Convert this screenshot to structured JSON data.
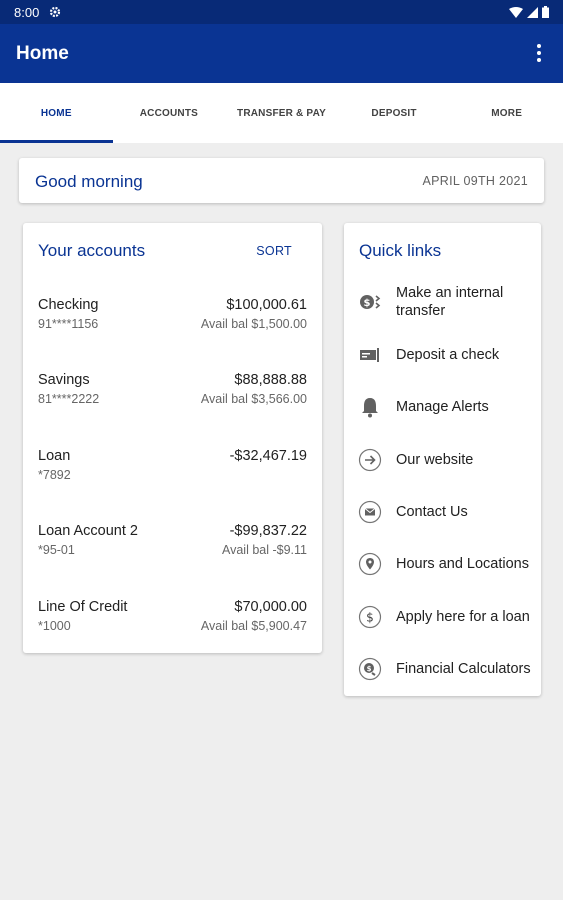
{
  "status": {
    "time": "8:00"
  },
  "appbar": {
    "title": "Home"
  },
  "tabs": [
    {
      "label": "HOME"
    },
    {
      "label": "ACCOUNTS"
    },
    {
      "label": "TRANSFER & PAY"
    },
    {
      "label": "DEPOSIT"
    },
    {
      "label": "MORE"
    }
  ],
  "greeting": {
    "text": "Good morning",
    "date": "APRIL 09TH 2021"
  },
  "accounts": {
    "title": "Your accounts",
    "sort_label": "SORT",
    "items": [
      {
        "name": "Checking",
        "number": "91****1156",
        "amount": "$100,000.61",
        "avail": "Avail bal $1,500.00"
      },
      {
        "name": "Savings",
        "number": "81****2222",
        "amount": "$88,888.88",
        "avail": "Avail bal $3,566.00"
      },
      {
        "name": "Loan",
        "number": "*7892",
        "amount": "-$32,467.19",
        "avail": ""
      },
      {
        "name": "Loan Account 2",
        "number": "*95-01",
        "amount": "-$99,837.22",
        "avail": "Avail bal -$9.11"
      },
      {
        "name": "Line Of Credit",
        "number": "*1000",
        "amount": "$70,000.00",
        "avail": "Avail bal $5,900.47"
      }
    ]
  },
  "quick_links": {
    "title": "Quick links",
    "items": [
      {
        "label": "Make an internal transfer",
        "icon": "transfer-icon"
      },
      {
        "label": "Deposit a check",
        "icon": "check-deposit-icon"
      },
      {
        "label": "Manage Alerts",
        "icon": "bell-icon"
      },
      {
        "label": "Our website",
        "icon": "arrow-right-circle-icon"
      },
      {
        "label": "Contact Us",
        "icon": "mail-circle-icon"
      },
      {
        "label": "Hours and Locations",
        "icon": "location-pin-icon"
      },
      {
        "label": "Apply here for a loan",
        "icon": "dollar-circle-icon"
      },
      {
        "label": "Financial Calculators",
        "icon": "calculator-icon"
      }
    ]
  },
  "colors": {
    "primary": "#0a3493",
    "status_bar": "#082a77",
    "background": "#eeeeee"
  }
}
